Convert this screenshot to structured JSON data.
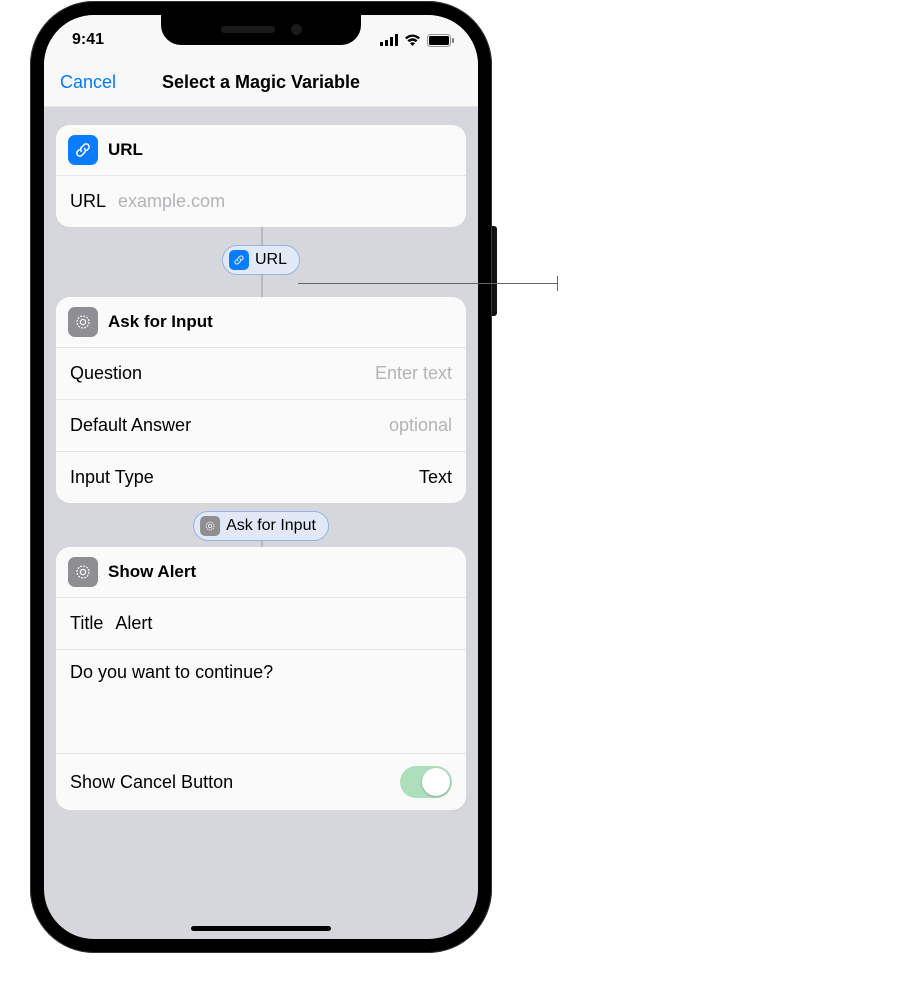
{
  "status": {
    "time": "9:41"
  },
  "nav": {
    "cancel": "Cancel",
    "title": "Select a Magic Variable"
  },
  "cards": {
    "url": {
      "title": "URL",
      "field_label": "URL",
      "field_placeholder": "example.com",
      "pill_label": "URL"
    },
    "ask": {
      "title": "Ask for Input",
      "rows": {
        "question_label": "Question",
        "question_placeholder": "Enter text",
        "default_label": "Default Answer",
        "default_placeholder": "optional",
        "type_label": "Input Type",
        "type_value": "Text"
      },
      "pill_label": "Ask for Input"
    },
    "alert": {
      "title": "Show Alert",
      "title_label": "Title",
      "title_value": "Alert",
      "message": "Do you want to continue?",
      "cancel_label": "Show Cancel Button",
      "cancel_on": true
    }
  }
}
